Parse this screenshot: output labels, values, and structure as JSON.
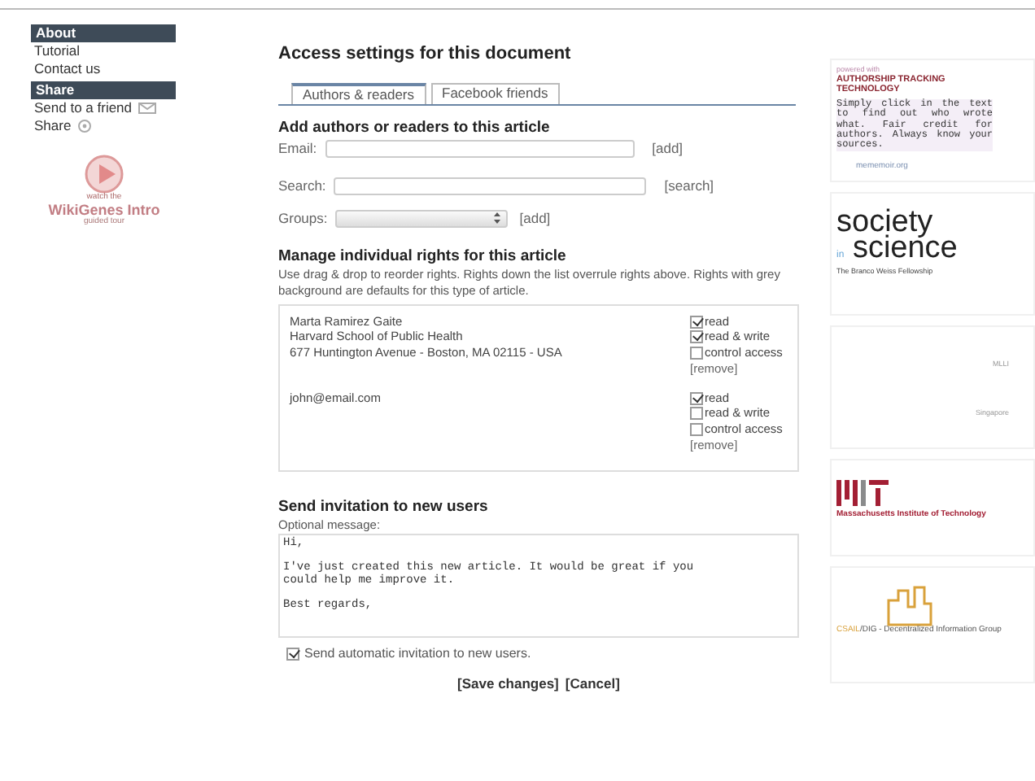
{
  "sidebar": {
    "sections": [
      {
        "title": "About",
        "links": [
          {
            "label": "Tutorial"
          },
          {
            "label": "Contact us"
          }
        ]
      },
      {
        "title": "Share",
        "links": [
          {
            "label": "Send to a friend",
            "kind": "mail"
          },
          {
            "label": "Share",
            "kind": "share"
          }
        ]
      }
    ],
    "promo": {
      "overline": "watch the",
      "title": "WikiGenes Intro",
      "subtitle": "guided tour"
    }
  },
  "main": {
    "title": "Access settings for this document",
    "tabs": [
      {
        "label": "Authors & readers",
        "selected": true
      },
      {
        "label": "Facebook friends",
        "selected": false
      }
    ],
    "add_section": {
      "heading": "Add authors or readers to this article",
      "fields": [
        {
          "label": "Email:",
          "kind": "text",
          "action": "[add]"
        },
        {
          "label": "Search:",
          "kind": "text",
          "action": "[search]"
        },
        {
          "label": "Groups:",
          "kind": "select",
          "action": "[add]"
        }
      ]
    },
    "rights": {
      "heading": "Manage individual rights for this article",
      "description": "Use drag & drop to reorder rights. Rights down the list overrule rights above. Rights with grey background are defaults for this type of article.",
      "entries": [
        {
          "lines": [
            "Marta Ramirez Gaite",
            "Harvard School of Public Health",
            "677 Huntington Avenue - Boston, MA 02115 - USA"
          ],
          "permissions": [
            {
              "label": "read",
              "checked": true
            },
            {
              "label": "read & write",
              "checked": true
            },
            {
              "label": "control access",
              "checked": false
            }
          ],
          "remove": "[remove]"
        },
        {
          "lines": [
            "john@email.com"
          ],
          "permissions": [
            {
              "label": "read",
              "checked": true
            },
            {
              "label": "read & write",
              "checked": false
            },
            {
              "label": "control access",
              "checked": false
            }
          ],
          "remove": "[remove]"
        }
      ]
    },
    "invitation": {
      "heading": "Send invitation to new users",
      "message_label": "Optional message:",
      "message": "Hi,\n\nI've just created this new article. It would be great if you\ncould help me improve it.\n\nBest regards,",
      "auto_send": {
        "label": "Send automatic invitation to new users.",
        "checked": true
      }
    },
    "actions": [
      "[Save changes]",
      "[Cancel]"
    ]
  },
  "sponsors": [
    {
      "kind": "authorship",
      "overline": "powered with",
      "title_lines": [
        "AUTHORSHIP TRACKING",
        "TECHNOLOGY"
      ],
      "text": "Simply click in the text to find out who wrote what. Fair credit for authors. Always know your sources.",
      "link": "mememoir.org"
    },
    {
      "kind": "society",
      "words": [
        "society",
        "in",
        "science"
      ],
      "caption": "The Branco Weiss Fellowship"
    },
    {
      "kind": "plain",
      "lines": [
        "MLLI",
        "Singapore"
      ]
    },
    {
      "kind": "mit",
      "caption": "Massachusetts Institute of Technology"
    },
    {
      "kind": "dig",
      "prefix": "CSAIL",
      "caption": "/DIG - Decentralized Information Group"
    }
  ]
}
